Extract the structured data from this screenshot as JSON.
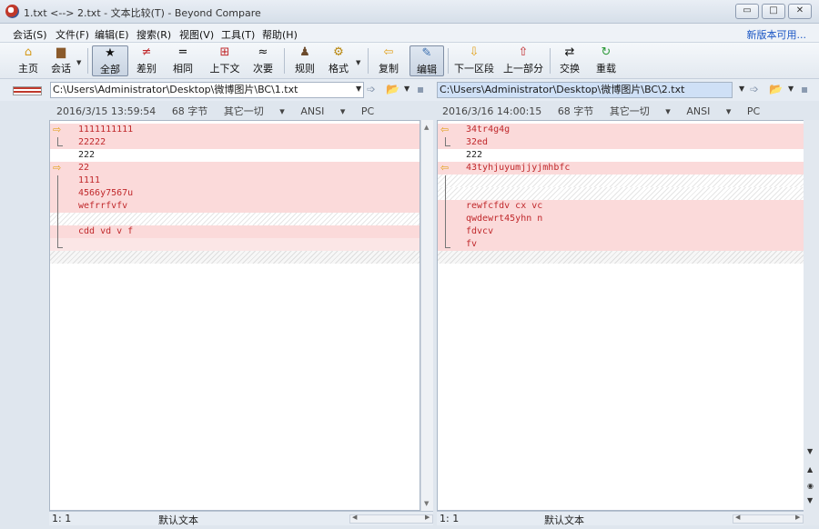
{
  "window": {
    "title": "1.txt <--> 2.txt - 文本比较(T) - Beyond Compare",
    "buttons": [
      "▭",
      "□",
      "✕"
    ]
  },
  "menu": {
    "items": [
      "会话(S)",
      "文件(F)",
      "编辑(E)",
      "搜索(R)",
      "视图(V)",
      "工具(T)",
      "帮助(H)"
    ],
    "link": "新版本可用..."
  },
  "toolbar": {
    "items": [
      {
        "label": "主页",
        "icon": "⌂"
      },
      {
        "label": "会话",
        "icon": "▆"
      },
      {
        "label": "全部",
        "icon": "★"
      },
      {
        "label": "差别",
        "icon": "≠"
      },
      {
        "label": "相同",
        "icon": "="
      },
      {
        "label": "上下文",
        "icon": "⊞"
      },
      {
        "label": "次要",
        "icon": "≈"
      },
      {
        "label": "规则",
        "icon": "♟"
      },
      {
        "label": "格式",
        "icon": "⚙"
      },
      {
        "label": "复制",
        "icon": "⇦"
      },
      {
        "label": "编辑",
        "icon": "✎"
      },
      {
        "label": "下一区段",
        "icon": "⇩"
      },
      {
        "label": "上一部分",
        "icon": "⇧"
      },
      {
        "label": "交换",
        "icon": "⇄"
      },
      {
        "label": "重载",
        "icon": "↻"
      }
    ],
    "active": "全部"
  },
  "left": {
    "path": "C:\\Users\\Administrator\\Desktop\\微博图片\\BC\\1.txt",
    "info": {
      "datetime": "2016/3/15 13:59:54",
      "size": "68 字节",
      "lines": "其它一切",
      "encoding": "ANSI",
      "eol": "PC"
    },
    "lines": [
      {
        "text": "1111111111",
        "kind": "diff"
      },
      {
        "text": "22222",
        "kind": "diff"
      },
      {
        "text": "222",
        "kind": "same"
      },
      {
        "text": "22",
        "kind": "diff"
      },
      {
        "text": "1111",
        "kind": "diff"
      },
      {
        "text": "4566y7567u",
        "kind": "diff"
      },
      {
        "text": "wefrrfvfv",
        "kind": "diff"
      },
      {
        "text": "",
        "kind": "blank"
      },
      {
        "text": "cdd vd v f",
        "kind": "diff"
      },
      {
        "text": "",
        "kind": "blank-pink"
      },
      {
        "text": "",
        "kind": "hatch-grey"
      }
    ],
    "status": {
      "pos": "1: 1",
      "type": "默认文本"
    }
  },
  "right": {
    "path": "C:\\Users\\Administrator\\Desktop\\微博图片\\BC\\2.txt",
    "info": {
      "datetime": "2016/3/16 14:00:15",
      "size": "68 字节",
      "lines": "其它一切",
      "encoding": "ANSI",
      "eol": "PC"
    },
    "lines": [
      {
        "text": "34tr4g4g",
        "kind": "diff"
      },
      {
        "text": "32ed",
        "kind": "diff"
      },
      {
        "text": "222",
        "kind": "same"
      },
      {
        "text": "43tyhjuyumjjyjmhbfc",
        "kind": "diff"
      },
      {
        "text": "",
        "kind": "blank"
      },
      {
        "text": "",
        "kind": "blank"
      },
      {
        "text": "rewfcfdv cx vc",
        "kind": "diff"
      },
      {
        "text": "qwdewrt45yhn n",
        "kind": "diff"
      },
      {
        "text": "fdvcv",
        "kind": "diff"
      },
      {
        "text": "fv",
        "kind": "diff"
      },
      {
        "text": "",
        "kind": "hatch-grey"
      }
    ],
    "status": {
      "pos": "1: 1",
      "type": "默认文本"
    }
  },
  "colors": {
    "diff_bg": "#fbdada",
    "diff_text": "#c0282b",
    "accent": "#e2a11c"
  }
}
